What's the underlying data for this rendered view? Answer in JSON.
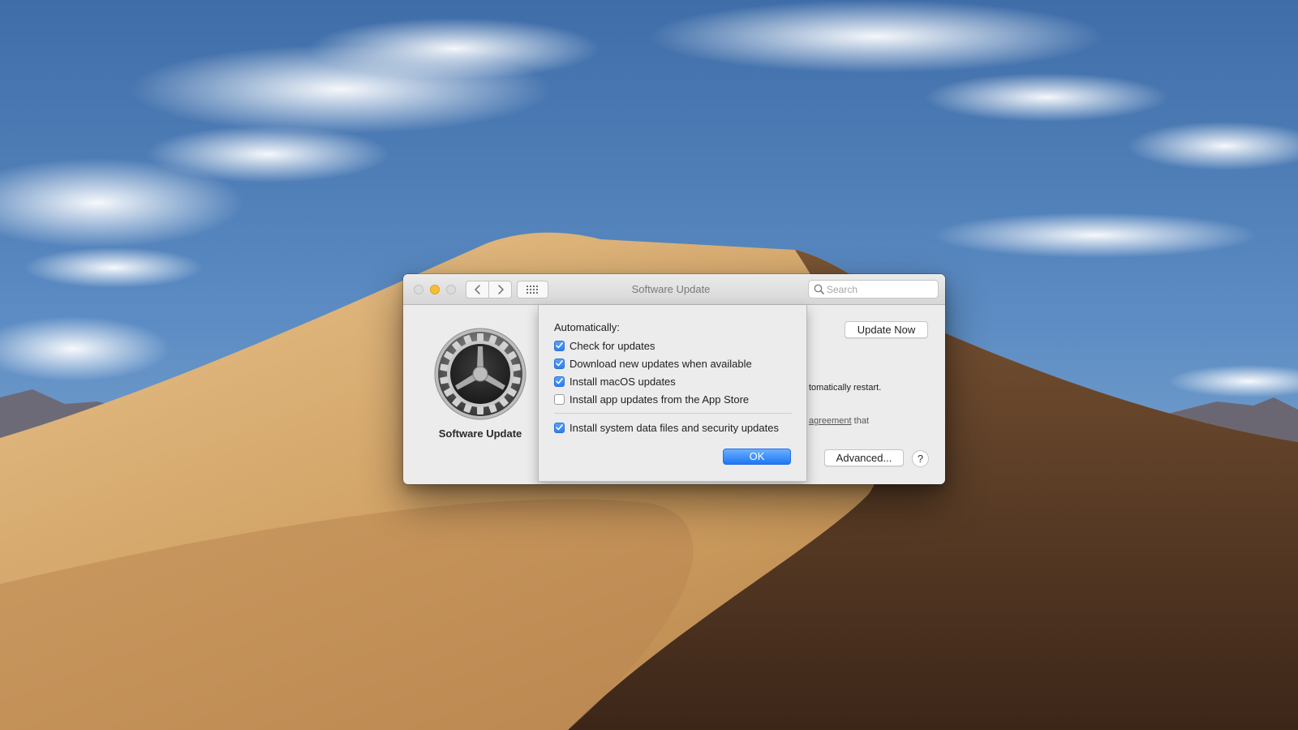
{
  "window": {
    "title": "Software Update",
    "search_placeholder": "Search"
  },
  "pane": {
    "name": "Software Update",
    "update_now_label": "Update Now",
    "restart_text_fragment": "tomatically restart.",
    "agreement_link_fragment": "agreement",
    "agreement_suffix": " that",
    "advanced_label": "Advanced...",
    "help_label": "?"
  },
  "sheet": {
    "heading": "Automatically:",
    "options": [
      {
        "label": "Check for updates",
        "checked": true
      },
      {
        "label": "Download new updates when available",
        "checked": true
      },
      {
        "label": "Install macOS updates",
        "checked": true
      },
      {
        "label": "Install app updates from the App Store",
        "checked": false
      }
    ],
    "security_option": {
      "label": "Install system data files and security updates",
      "checked": true
    },
    "ok_label": "OK"
  },
  "colors": {
    "accent": "#2d7ff0",
    "minimize": "#f5bf2f"
  },
  "icons": {
    "back": "chevron-left-icon",
    "forward": "chevron-right-icon",
    "grid": "grid-icon",
    "search": "magnifier-icon",
    "pane": "gear-icon"
  }
}
